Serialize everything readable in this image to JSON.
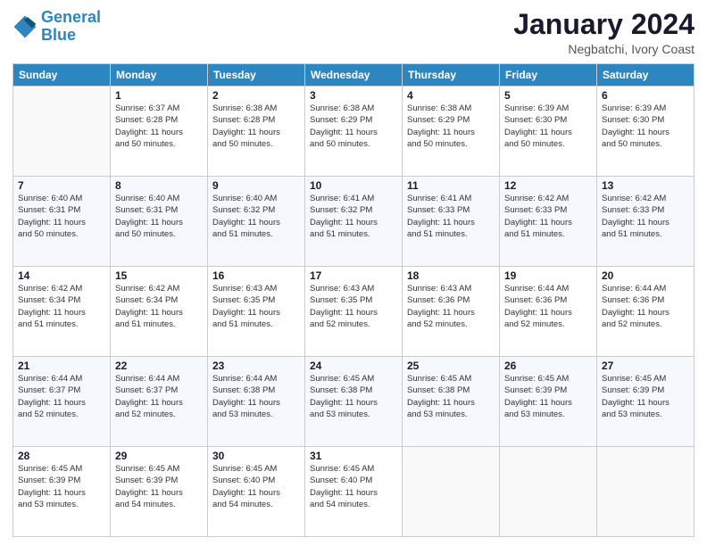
{
  "logo": {
    "text_general": "General",
    "text_blue": "Blue"
  },
  "header": {
    "title": "January 2024",
    "subtitle": "Negbatchi, Ivory Coast"
  },
  "days_of_week": [
    "Sunday",
    "Monday",
    "Tuesday",
    "Wednesday",
    "Thursday",
    "Friday",
    "Saturday"
  ],
  "weeks": [
    [
      {
        "day": "",
        "info": ""
      },
      {
        "day": "1",
        "info": "Sunrise: 6:37 AM\nSunset: 6:28 PM\nDaylight: 11 hours\nand 50 minutes."
      },
      {
        "day": "2",
        "info": "Sunrise: 6:38 AM\nSunset: 6:28 PM\nDaylight: 11 hours\nand 50 minutes."
      },
      {
        "day": "3",
        "info": "Sunrise: 6:38 AM\nSunset: 6:29 PM\nDaylight: 11 hours\nand 50 minutes."
      },
      {
        "day": "4",
        "info": "Sunrise: 6:38 AM\nSunset: 6:29 PM\nDaylight: 11 hours\nand 50 minutes."
      },
      {
        "day": "5",
        "info": "Sunrise: 6:39 AM\nSunset: 6:30 PM\nDaylight: 11 hours\nand 50 minutes."
      },
      {
        "day": "6",
        "info": "Sunrise: 6:39 AM\nSunset: 6:30 PM\nDaylight: 11 hours\nand 50 minutes."
      }
    ],
    [
      {
        "day": "7",
        "info": "Sunrise: 6:40 AM\nSunset: 6:31 PM\nDaylight: 11 hours\nand 50 minutes."
      },
      {
        "day": "8",
        "info": "Sunrise: 6:40 AM\nSunset: 6:31 PM\nDaylight: 11 hours\nand 50 minutes."
      },
      {
        "day": "9",
        "info": "Sunrise: 6:40 AM\nSunset: 6:32 PM\nDaylight: 11 hours\nand 51 minutes."
      },
      {
        "day": "10",
        "info": "Sunrise: 6:41 AM\nSunset: 6:32 PM\nDaylight: 11 hours\nand 51 minutes."
      },
      {
        "day": "11",
        "info": "Sunrise: 6:41 AM\nSunset: 6:33 PM\nDaylight: 11 hours\nand 51 minutes."
      },
      {
        "day": "12",
        "info": "Sunrise: 6:42 AM\nSunset: 6:33 PM\nDaylight: 11 hours\nand 51 minutes."
      },
      {
        "day": "13",
        "info": "Sunrise: 6:42 AM\nSunset: 6:33 PM\nDaylight: 11 hours\nand 51 minutes."
      }
    ],
    [
      {
        "day": "14",
        "info": "Sunrise: 6:42 AM\nSunset: 6:34 PM\nDaylight: 11 hours\nand 51 minutes."
      },
      {
        "day": "15",
        "info": "Sunrise: 6:42 AM\nSunset: 6:34 PM\nDaylight: 11 hours\nand 51 minutes."
      },
      {
        "day": "16",
        "info": "Sunrise: 6:43 AM\nSunset: 6:35 PM\nDaylight: 11 hours\nand 51 minutes."
      },
      {
        "day": "17",
        "info": "Sunrise: 6:43 AM\nSunset: 6:35 PM\nDaylight: 11 hours\nand 52 minutes."
      },
      {
        "day": "18",
        "info": "Sunrise: 6:43 AM\nSunset: 6:36 PM\nDaylight: 11 hours\nand 52 minutes."
      },
      {
        "day": "19",
        "info": "Sunrise: 6:44 AM\nSunset: 6:36 PM\nDaylight: 11 hours\nand 52 minutes."
      },
      {
        "day": "20",
        "info": "Sunrise: 6:44 AM\nSunset: 6:36 PM\nDaylight: 11 hours\nand 52 minutes."
      }
    ],
    [
      {
        "day": "21",
        "info": "Sunrise: 6:44 AM\nSunset: 6:37 PM\nDaylight: 11 hours\nand 52 minutes."
      },
      {
        "day": "22",
        "info": "Sunrise: 6:44 AM\nSunset: 6:37 PM\nDaylight: 11 hours\nand 52 minutes."
      },
      {
        "day": "23",
        "info": "Sunrise: 6:44 AM\nSunset: 6:38 PM\nDaylight: 11 hours\nand 53 minutes."
      },
      {
        "day": "24",
        "info": "Sunrise: 6:45 AM\nSunset: 6:38 PM\nDaylight: 11 hours\nand 53 minutes."
      },
      {
        "day": "25",
        "info": "Sunrise: 6:45 AM\nSunset: 6:38 PM\nDaylight: 11 hours\nand 53 minutes."
      },
      {
        "day": "26",
        "info": "Sunrise: 6:45 AM\nSunset: 6:39 PM\nDaylight: 11 hours\nand 53 minutes."
      },
      {
        "day": "27",
        "info": "Sunrise: 6:45 AM\nSunset: 6:39 PM\nDaylight: 11 hours\nand 53 minutes."
      }
    ],
    [
      {
        "day": "28",
        "info": "Sunrise: 6:45 AM\nSunset: 6:39 PM\nDaylight: 11 hours\nand 53 minutes."
      },
      {
        "day": "29",
        "info": "Sunrise: 6:45 AM\nSunset: 6:39 PM\nDaylight: 11 hours\nand 54 minutes."
      },
      {
        "day": "30",
        "info": "Sunrise: 6:45 AM\nSunset: 6:40 PM\nDaylight: 11 hours\nand 54 minutes."
      },
      {
        "day": "31",
        "info": "Sunrise: 6:45 AM\nSunset: 6:40 PM\nDaylight: 11 hours\nand 54 minutes."
      },
      {
        "day": "",
        "info": ""
      },
      {
        "day": "",
        "info": ""
      },
      {
        "day": "",
        "info": ""
      }
    ]
  ]
}
